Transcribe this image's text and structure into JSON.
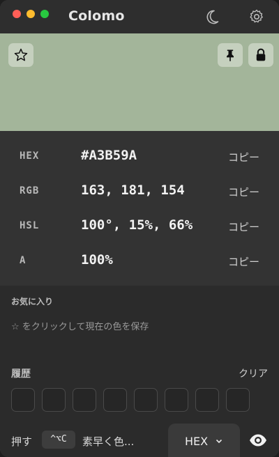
{
  "app": {
    "title": "Colomo"
  },
  "titlebar": {
    "icons": [
      "moon-icon",
      "gear-icon"
    ]
  },
  "swatch": {
    "color": "#A3B59A",
    "buttons": [
      "star-icon",
      "pin-icon",
      "lock-icon"
    ]
  },
  "values": [
    {
      "label": "HEX",
      "value": "#A3B59A",
      "copy": "コピー"
    },
    {
      "label": "RGB",
      "value": "163, 181, 154",
      "copy": "コピー"
    },
    {
      "label": "HSL",
      "value": "100°, 15%, 66%",
      "copy": "コピー"
    },
    {
      "label": "A",
      "value": "100%",
      "copy": "コピー"
    }
  ],
  "favorites": {
    "title": "お気に入り",
    "hint": "☆ をクリックして現在の色を保存"
  },
  "history": {
    "title": "履歴",
    "clear_label": "クリア",
    "slots": 8
  },
  "bottom": {
    "press_label": "押す",
    "shortcut": "^⌥C",
    "tail_label": "素早く色...",
    "format_label": "HEX",
    "eye_icon": "eye-icon"
  }
}
